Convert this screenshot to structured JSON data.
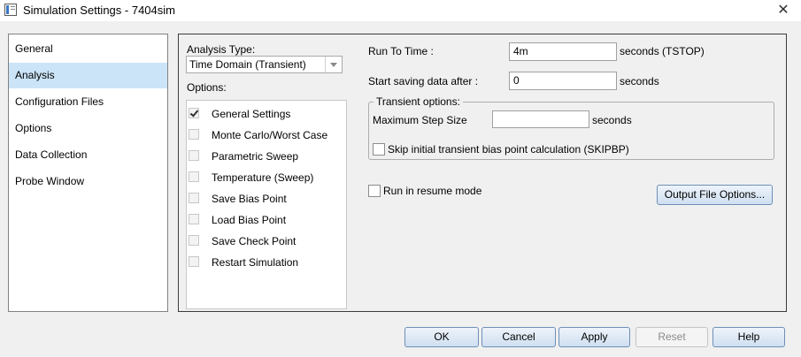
{
  "window": {
    "title": "Simulation Settings - 7404sim"
  },
  "nav": {
    "items": [
      {
        "label": "General"
      },
      {
        "label": "Analysis"
      },
      {
        "label": "Configuration Files"
      },
      {
        "label": "Options"
      },
      {
        "label": "Data Collection"
      },
      {
        "label": "Probe Window"
      }
    ],
    "selected": "Analysis"
  },
  "analysis": {
    "type_label": "Analysis Type:",
    "type_value": "Time Domain (Transient)",
    "options_label": "Options:",
    "options": [
      {
        "label": "General Settings",
        "checked": true
      },
      {
        "label": "Monte Carlo/Worst Case",
        "checked": false
      },
      {
        "label": "Parametric Sweep",
        "checked": false
      },
      {
        "label": "Temperature (Sweep)",
        "checked": false
      },
      {
        "label": "Save Bias Point",
        "checked": false
      },
      {
        "label": "Load Bias Point",
        "checked": false
      },
      {
        "label": "Save Check Point",
        "checked": false
      },
      {
        "label": "Restart Simulation",
        "checked": false
      }
    ]
  },
  "transient": {
    "run_to_time_label": "Run To Time :",
    "run_to_time_value": "4m",
    "run_to_time_unit": "seconds (TSTOP)",
    "start_saving_label": "Start saving data after :",
    "start_saving_value": "0",
    "start_saving_unit": "seconds",
    "group_label": "Transient options:",
    "max_step_label": "Maximum Step Size",
    "max_step_value": "",
    "max_step_unit": "seconds",
    "skipbp_label": "Skip initial transient bias point calculation (SKIPBP)",
    "resume_label": "Run in resume mode",
    "output_file_options_label": "Output File Options..."
  },
  "footer": {
    "ok": "OK",
    "cancel": "Cancel",
    "apply": "Apply",
    "reset": "Reset",
    "help": "Help"
  }
}
